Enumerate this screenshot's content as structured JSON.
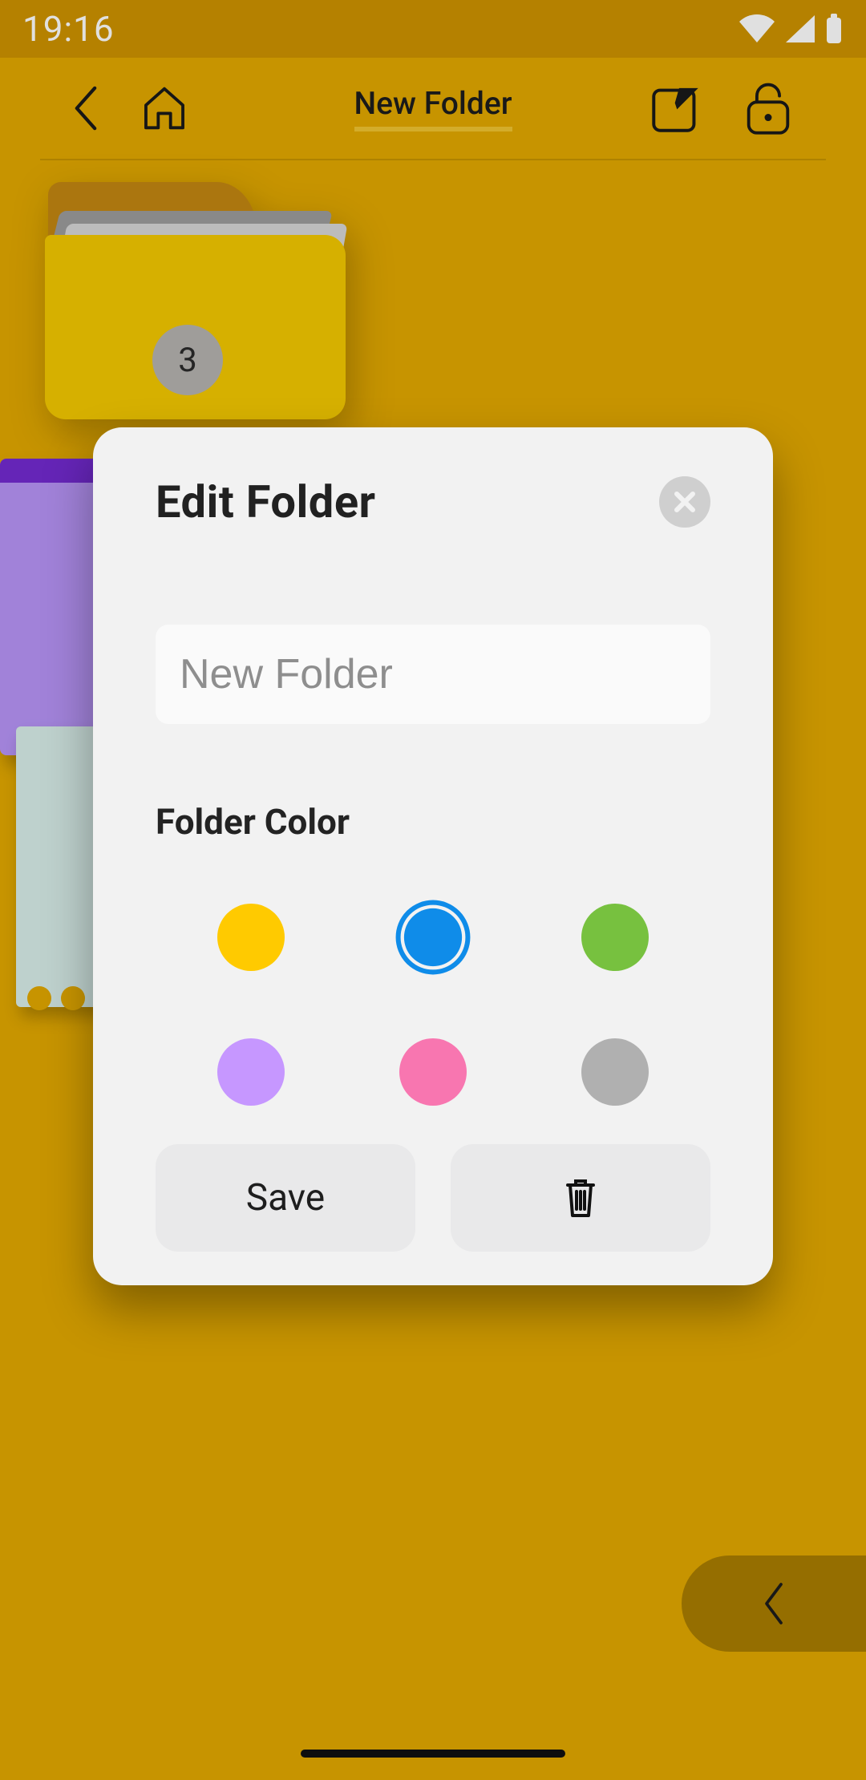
{
  "statusbar": {
    "time": "19:16"
  },
  "header": {
    "title": "New Folder"
  },
  "folder_badge": "3",
  "modal": {
    "title": "Edit Folder",
    "name_placeholder": "New Folder",
    "name_value": "",
    "section_label": "Folder Color",
    "colors": [
      {
        "name": "yellow",
        "hex": "#ffca00",
        "selected": false
      },
      {
        "name": "blue",
        "hex": "#0f8ce9",
        "selected": true
      },
      {
        "name": "green",
        "hex": "#77c13f",
        "selected": false
      },
      {
        "name": "purple",
        "hex": "#c697ff",
        "selected": false
      },
      {
        "name": "pink",
        "hex": "#f876b0",
        "selected": false
      },
      {
        "name": "grey",
        "hex": "#b0b0b0",
        "selected": false
      }
    ],
    "save_label": "Save"
  }
}
